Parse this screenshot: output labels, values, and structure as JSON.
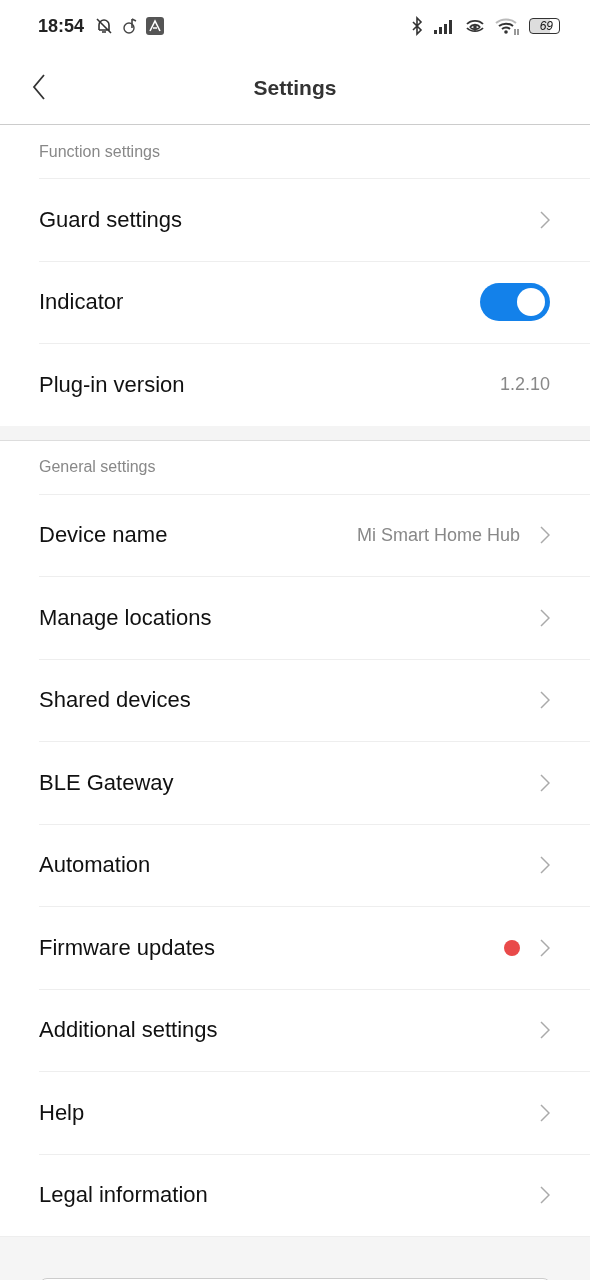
{
  "status_bar": {
    "time": "18:54",
    "battery": "69"
  },
  "header": {
    "title": "Settings"
  },
  "sections": [
    {
      "title": "Function settings",
      "items": [
        {
          "kind": "link",
          "label": "Guard settings"
        },
        {
          "kind": "toggle",
          "label": "Indicator",
          "on": true
        },
        {
          "kind": "value",
          "label": "Plug-in version",
          "value": "1.2.10"
        }
      ]
    },
    {
      "title": "General settings",
      "items": [
        {
          "kind": "link",
          "label": "Device name",
          "value": "Mi Smart Home Hub"
        },
        {
          "kind": "link",
          "label": "Manage locations"
        },
        {
          "kind": "link",
          "label": "Shared devices"
        },
        {
          "kind": "link",
          "label": "BLE Gateway"
        },
        {
          "kind": "link",
          "label": "Automation"
        },
        {
          "kind": "link",
          "label": "Firmware updates",
          "badge": true
        },
        {
          "kind": "link",
          "label": "Additional settings"
        },
        {
          "kind": "link",
          "label": "Help"
        },
        {
          "kind": "link",
          "label": "Legal information"
        }
      ]
    }
  ]
}
